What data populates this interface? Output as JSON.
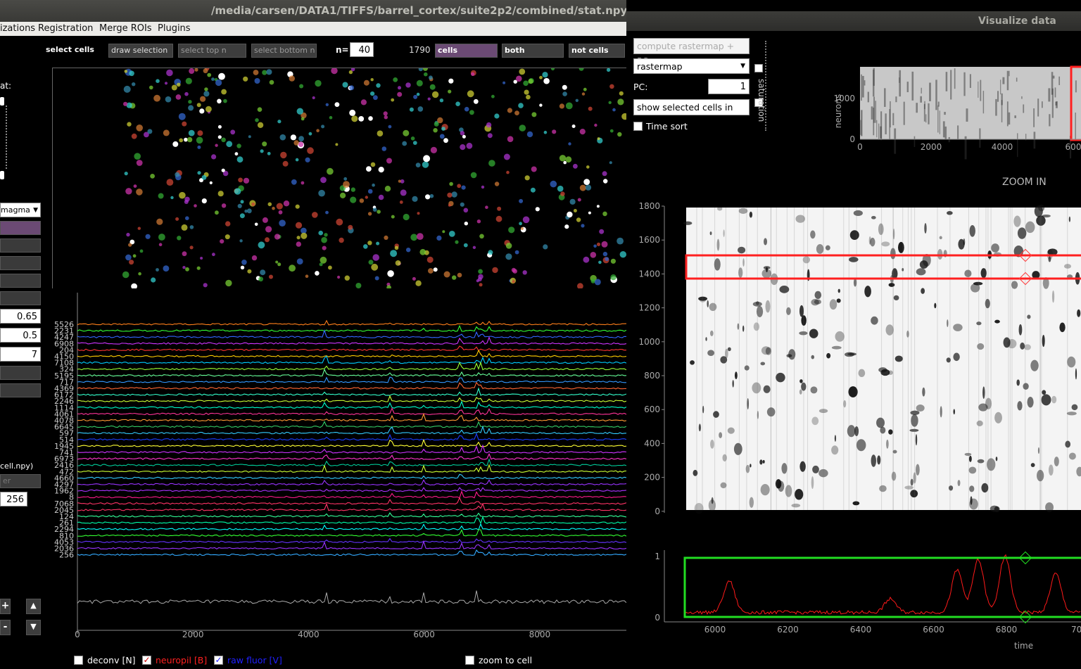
{
  "main_window": {
    "title": "/media/carsen/DATA1/TIFFS/barrel_cortex/suite2p2/combined/stat.npy",
    "menu": [
      "izations",
      "Registration",
      "Merge ROIs",
      "Plugins"
    ],
    "selection_bar": {
      "select_cells_label": "select cells",
      "draw_selection": "draw selection",
      "select_top_n": "select top n",
      "select_bottom_n": "select bottom n",
      "n_label": "n=",
      "n_value": "40",
      "cell_count": "1790",
      "cells": "cells",
      "both": "both",
      "not_cells": "not cells"
    },
    "left_panel": {
      "stat_label": "at:",
      "colormap": "magma",
      "values": [
        "0.65",
        "0.5",
        "7"
      ],
      "file_label": "cell.npy)",
      "filter_placeholder": "er",
      "bin_value": "256",
      "plus": "+",
      "minus": "-",
      "up": "▲",
      "down": "▼"
    },
    "trace_labels": [
      "5526",
      "2231",
      "4247",
      "6908",
      "204",
      "4150",
      "7108",
      "324",
      "5195",
      "717",
      "4369",
      "6172",
      "2246",
      "1114",
      "4061",
      "4078",
      "6645",
      "597",
      "514",
      "1945",
      "741",
      "6973",
      "2416",
      "472",
      "4660",
      "4297",
      "1962",
      "8",
      "7068",
      "2045",
      "124",
      "261",
      "2294",
      "810",
      "4053",
      "2036",
      "256"
    ],
    "trace_colors": [
      "#ff7f1a",
      "#33ff33",
      "#3366ff",
      "#cc33ff",
      "#ff3333",
      "#ffcc00",
      "#00ccff",
      "#99ff33",
      "#66ff99",
      "#3399ff",
      "#ff6633",
      "#33ffcc",
      "#ccff33",
      "#00ffcc",
      "#ff3399",
      "#ff9933",
      "#33cc66",
      "#33ccff",
      "#1a3dff",
      "#ffff33",
      "#cc33ff",
      "#ff33cc",
      "#00cc99",
      "#ccff33",
      "#33ccff",
      "#9933ff",
      "#aa33ff",
      "#ff1a8c",
      "#ff3366",
      "#ff3366",
      "#33ff99",
      "#00ffaa",
      "#00ffff",
      "#33ff33",
      "#6633ff",
      "#9933ff",
      "#33aaff"
    ],
    "x_ticks": [
      "0",
      "2000",
      "4000",
      "6000",
      "8000"
    ],
    "checkboxes": {
      "deconv": "deconv [N]",
      "neuropil": "neuropil [B]",
      "raw_fluor": "raw fluor [V]",
      "zoom_to_cell": "zoom to cell"
    },
    "colors": {
      "cells_active": "#6b4a74",
      "neuropil": "#ff2020",
      "raw_fluor": "#2020ff"
    }
  },
  "viz_window": {
    "title": "Visualize data",
    "compute_button": "compute rastermap + PCs",
    "sort_select": "rastermap",
    "pc_label": "PC:",
    "pc_value": "1",
    "show_selected": "show selected cells in GUI",
    "time_sort": "Time sort",
    "saturation_label": "saturation",
    "overview": {
      "ylabel": "neurons",
      "y_ticks": [
        "1000",
        "0"
      ],
      "x_ticks": [
        "0",
        "2000",
        "4000",
        "600"
      ]
    },
    "zoom_title": "ZOOM IN",
    "zoom_y_ticks": [
      "1800",
      "1600",
      "1400",
      "1200",
      "1000",
      "800",
      "600",
      "400",
      "200",
      "0"
    ],
    "trace_panel": {
      "y_ticks": [
        "1",
        "0"
      ],
      "x_ticks": [
        "6000",
        "6200",
        "6400",
        "6600",
        "6800",
        "700"
      ],
      "xlabel": "time"
    }
  }
}
